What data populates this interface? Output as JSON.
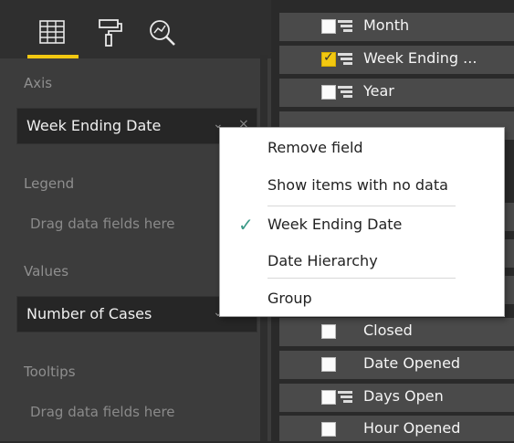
{
  "viz_pane": {
    "tabs": [
      {
        "icon": "fields-grid-icon"
      },
      {
        "icon": "format-paint-roller-icon"
      },
      {
        "icon": "analytics-magnifier-icon"
      }
    ],
    "accent_color": "#f2c811",
    "axis": {
      "label": "Axis",
      "field": "Week Ending Date"
    },
    "legend": {
      "label": "Legend",
      "placeholder": "Drag data fields here"
    },
    "values": {
      "label": "Values",
      "field": "Number of Cases"
    },
    "tooltips": {
      "label": "Tooltips",
      "placeholder": "Drag data fields here"
    }
  },
  "fields_pane": {
    "items": [
      {
        "label": "Month",
        "checked": false,
        "hierarchy": true
      },
      {
        "label": "Week Ending ...",
        "checked": true,
        "hierarchy": true
      },
      {
        "label": "Year",
        "checked": false,
        "hierarchy": true
      },
      {
        "label": "Closed",
        "checked": false,
        "hierarchy": false
      },
      {
        "label": "Date Opened",
        "checked": false,
        "hierarchy": false
      },
      {
        "label": "Days Open",
        "checked": false,
        "hierarchy": true
      },
      {
        "label": "Hour Opened",
        "checked": false,
        "hierarchy": false
      }
    ]
  },
  "context_menu": {
    "items": [
      {
        "label": "Remove field",
        "checked": false
      },
      {
        "label": "Show items with no data",
        "checked": false
      },
      {
        "label": "Week Ending Date",
        "checked": true
      },
      {
        "label": "Date Hierarchy",
        "checked": false
      },
      {
        "label": "Group",
        "checked": false
      }
    ],
    "check_color": "#3c9a88"
  }
}
